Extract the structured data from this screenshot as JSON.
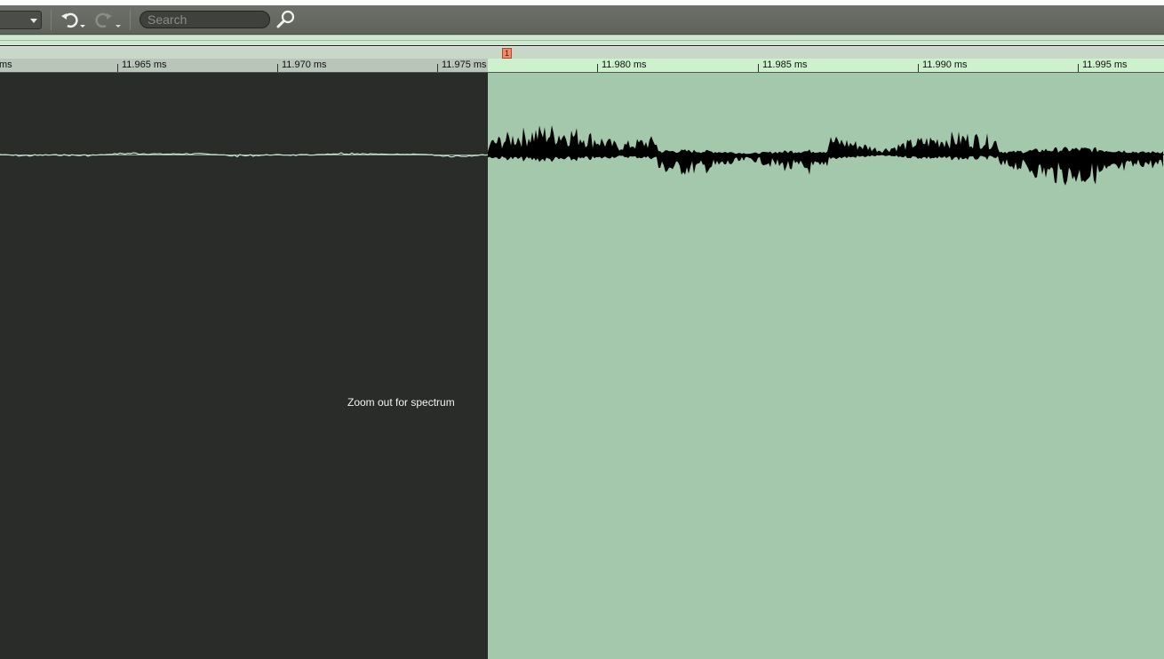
{
  "toolbar": {
    "dropdown_value": "",
    "search_placeholder": "Search",
    "icons": [
      "undo-icon",
      "redo-icon",
      "magnifier-icon",
      "chevron-down-icon"
    ]
  },
  "timeline": {
    "unit": "ms",
    "ticks": [
      "ms",
      "11.965 ms",
      "11.970 ms",
      "11.975 ms",
      "11.980 ms",
      "11.985 ms",
      "11.990 ms",
      "11.995 ms"
    ],
    "selection_start_ms": 11.975,
    "visible_range_ms": [
      11.9613,
      11.9975
    ]
  },
  "marker": {
    "label": "1"
  },
  "editor": {
    "spectrum_message": "Zoom out for spectrum",
    "colors": {
      "unselected_bg": "#2a2c29",
      "selected_bg": "#a3c8ab",
      "wave_unselected": "#bfe8cf",
      "wave_selected": "#000000",
      "marker": "#f08a6a"
    }
  }
}
